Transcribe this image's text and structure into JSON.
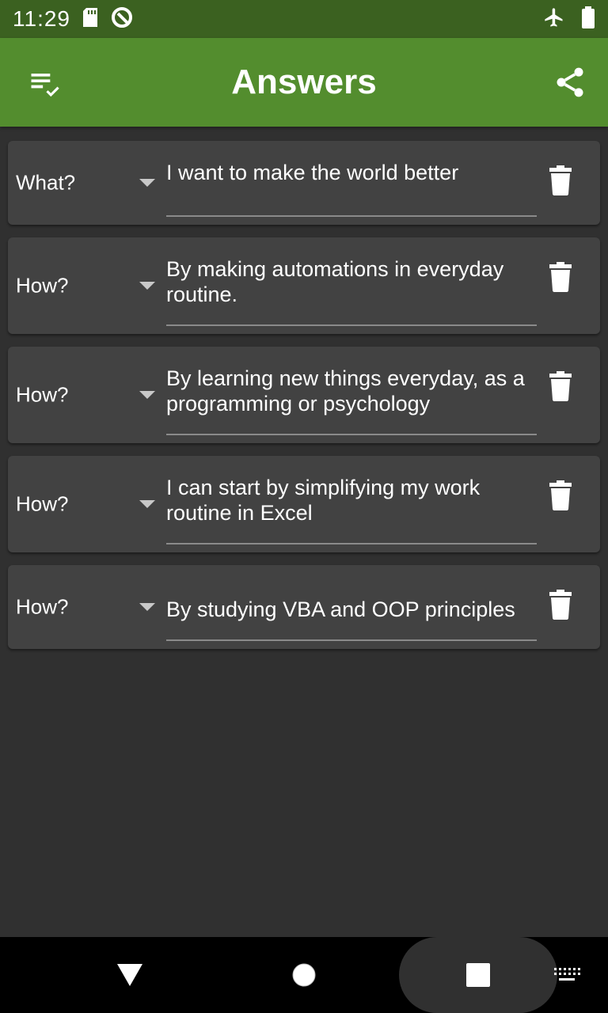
{
  "status_bar": {
    "time": "11:29",
    "icons": [
      "sd-card-icon",
      "data-saver-icon",
      "airplane-mode-icon",
      "battery-icon"
    ]
  },
  "app_bar": {
    "title": "Answers",
    "left_icon": "playlist-check-icon",
    "right_icon": "share-icon",
    "color": "#538d2e",
    "status_color": "#3b6120"
  },
  "answers": [
    {
      "label": "What?",
      "text": "I want to make the world better"
    },
    {
      "label": "How?",
      "text": "By making automations in everyday routine."
    },
    {
      "label": "How?",
      "text": "By learning new things everyday, as a programming or psychology"
    },
    {
      "label": "How?",
      "text": "I can start by simplifying my work routine in Excel"
    },
    {
      "label": "How?",
      "text": "By studying VBA and OOP principles"
    }
  ],
  "card_icons": {
    "dropdown": "dropdown-arrow-icon",
    "delete": "trash-icon"
  },
  "nav_bar": {
    "icons": [
      "back-icon",
      "home-icon",
      "recents-icon",
      "keyboard-icon"
    ]
  },
  "colors": {
    "background": "#303030",
    "card": "#424242",
    "text": "#ffffff"
  }
}
